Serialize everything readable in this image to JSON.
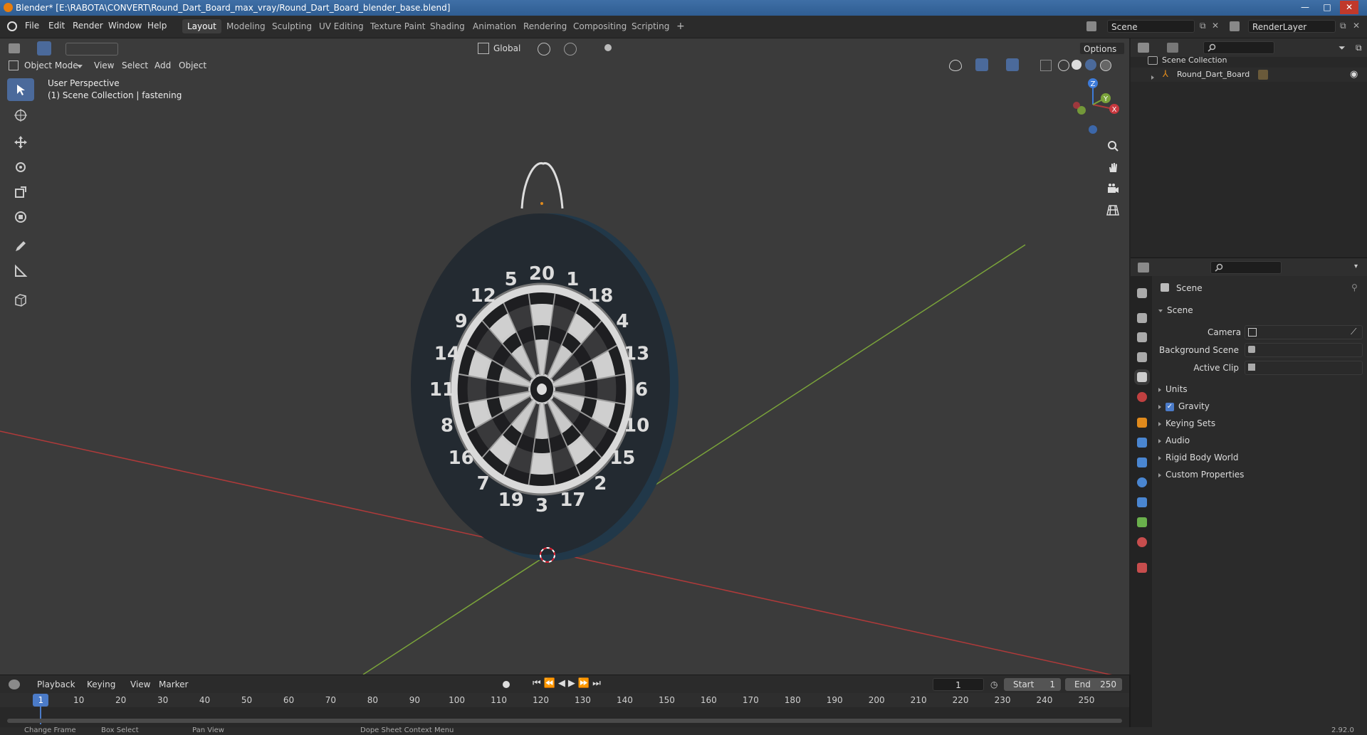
{
  "titlebar": {
    "title": "Blender* [E:\\RABOTA\\CONVERT\\Round_Dart_Board_max_vray/Round_Dart_Board_blender_base.blend]",
    "minimize": "—",
    "maximize": "□",
    "close": "✕"
  },
  "menu": [
    "File",
    "Edit",
    "Render",
    "Window",
    "Help"
  ],
  "workspaces": [
    "Layout",
    "Modeling",
    "Sculpting",
    "UV Editing",
    "Texture Paint",
    "Shading",
    "Animation",
    "Rendering",
    "Compositing",
    "Scripting"
  ],
  "workspace_add": "+",
  "scene_field": "Scene",
  "renderlayer_field": "RenderLayer",
  "vp_header": {
    "orientation": "Global",
    "options": "Options",
    "mode": "Object Mode",
    "menus": [
      "View",
      "Select",
      "Add",
      "Object"
    ]
  },
  "viewport": {
    "perspective": "User Perspective",
    "collection_info": "(1) Scene Collection | fastening",
    "gizmo": {
      "x": "X",
      "y": "Y",
      "z": "Z"
    }
  },
  "dartboard": {
    "numbers": [
      "20",
      "1",
      "18",
      "4",
      "13",
      "6",
      "10",
      "15",
      "2",
      "17",
      "3",
      "19",
      "7",
      "16",
      "8",
      "11",
      "14",
      "9",
      "12",
      "5"
    ]
  },
  "outliner": {
    "root": "Scene Collection",
    "items": [
      {
        "label": "Round_Dart_Board"
      }
    ]
  },
  "properties": {
    "context": "Scene",
    "panel": "Scene",
    "fields": [
      {
        "label": "Camera"
      },
      {
        "label": "Background Scene"
      },
      {
        "label": "Active Clip"
      }
    ],
    "sections": [
      "Units",
      "Gravity",
      "Keying Sets",
      "Audio",
      "Rigid Body World",
      "Custom Properties"
    ],
    "gravity_checked": true
  },
  "timeline": {
    "menus": [
      "Playback",
      "Keying",
      "View",
      "Marker"
    ],
    "current_frame": "1",
    "start_label": "Start",
    "start": "1",
    "end_label": "End",
    "end": "250",
    "ticks": [
      "1",
      "10",
      "20",
      "30",
      "40",
      "50",
      "60",
      "70",
      "80",
      "90",
      "100",
      "110",
      "120",
      "130",
      "140",
      "150",
      "160",
      "170",
      "180",
      "190",
      "200",
      "210",
      "220",
      "230",
      "240",
      "250"
    ]
  },
  "statusbar": {
    "items": [
      "Change Frame",
      "Box Select",
      "Pan View",
      "Dope Sheet Context Menu"
    ],
    "version": "2.92.0"
  },
  "colors": {
    "accent": "#4b6a9b",
    "x_axis": "#b03a3a",
    "y_axis": "#7aa33a",
    "z_axis": "#3d7bd9"
  }
}
